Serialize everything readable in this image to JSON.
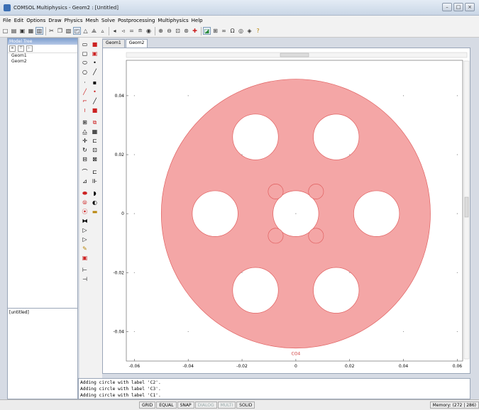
{
  "window": {
    "title": "COMSOL Multiphysics - Geom2 : [Untitled]"
  },
  "menu": [
    "File",
    "Edit",
    "Options",
    "Draw",
    "Physics",
    "Mesh",
    "Solve",
    "Postprocessing",
    "Multiphysics",
    "Help"
  ],
  "model_tree": {
    "title": "Model Tree",
    "items": [
      "Geom1",
      "Geom2"
    ],
    "lower_label": "[untitled]"
  },
  "tabs": [
    "Geom1",
    "Geom2"
  ],
  "axes": {
    "x_ticks": [
      "-0.06",
      "-0.04",
      "-0.02",
      "0",
      "0.02",
      "0.04",
      "0.06"
    ],
    "y_ticks": [
      "0.04",
      "0.02",
      "0",
      "-0.02",
      "-0.04"
    ],
    "object_label": "CO4"
  },
  "log": [
    "Adding circle with label 'C2'.",
    "Adding circle with label 'C3'.",
    "Adding circle with label 'C1'."
  ],
  "status": {
    "cells": [
      "GRID",
      "EQUAL",
      "SNAP",
      "DIALOG",
      "MULTI",
      "SOLID"
    ],
    "memory": "Memory: (272 | 286)"
  },
  "colors": {
    "geometry_fill": "#f4a6a6",
    "geometry_stroke": "#e06060"
  }
}
